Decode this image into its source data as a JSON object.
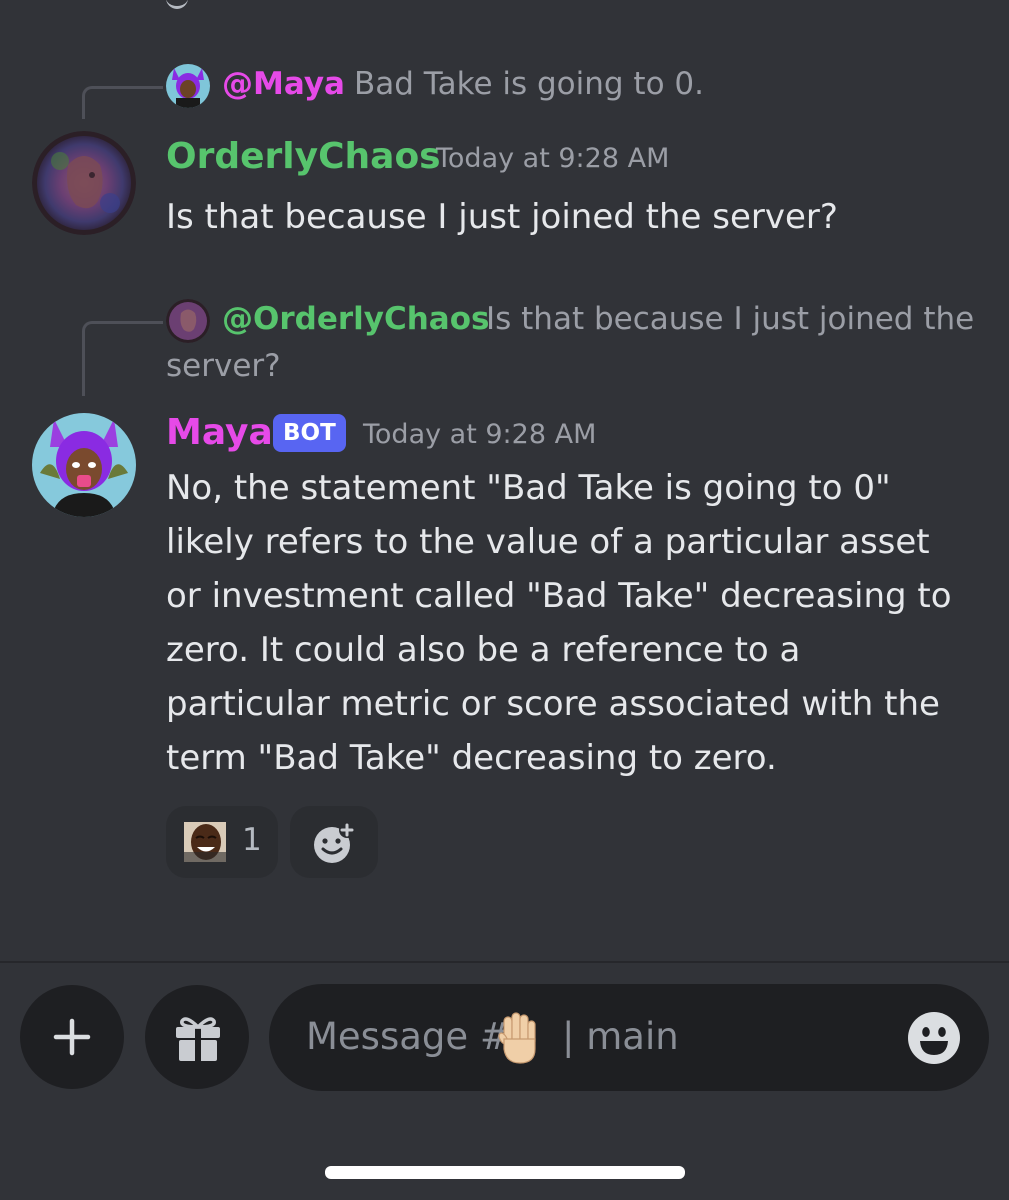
{
  "reply1": {
    "mention": "@Maya",
    "text": "Bad Take is going to 0."
  },
  "message1": {
    "author": "OrderlyChaos",
    "timestamp": "Today at 9:28 AM",
    "text": "Is that because I just joined the server?"
  },
  "reply2": {
    "mention": "@OrderlyChaos",
    "text_line1": "Is that because I just joined the",
    "text_line2": "server?"
  },
  "message2": {
    "author": "Maya",
    "badge": "BOT",
    "timestamp": "Today at 9:28 AM",
    "lines": [
      "No, the statement \"Bad Take is going to 0\"",
      "likely refers to the value of a particular asset",
      "or investment called \"Bad Take\" decreasing to",
      "zero. It could also be a reference to a",
      "particular metric or score associated with the",
      "term \"Bad Take\" decreasing to zero."
    ]
  },
  "reactions": [
    {
      "emoji": "laughing-man-emoji",
      "count": "1"
    },
    {
      "emoji": "add-reaction-icon"
    }
  ],
  "composer": {
    "placeholder_prefix": "Message #",
    "placeholder_suffix": "| main",
    "channel_emoji": "raised-hand-emoji"
  },
  "colors": {
    "orderly_chaos": "#57c46d",
    "maya": "#e64ae8",
    "bot_badge": "#5865f2",
    "background": "#313338"
  }
}
